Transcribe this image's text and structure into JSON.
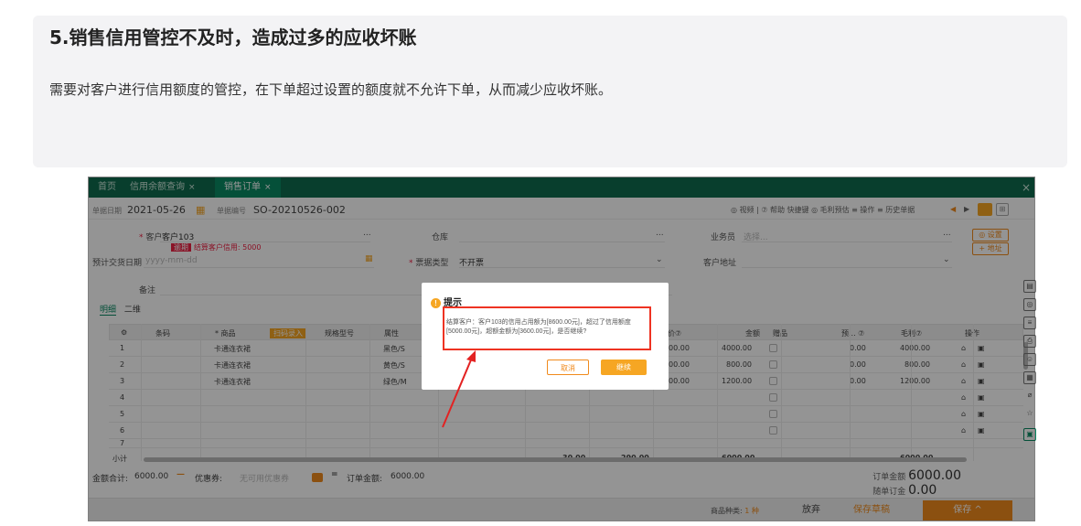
{
  "hero": {
    "title": "5.销售信用管控不及时，造成过多的应收坏账",
    "description": "需要对客户进行信用额度的管控，在下单超过设置的额度就不允许下单，从而减少应收坏账。"
  },
  "tabs": [
    {
      "label": "首页"
    },
    {
      "label": "信用余额查询"
    },
    {
      "label": "销售订单"
    }
  ],
  "tab_close": "×",
  "window_close": "×",
  "toolbar": {
    "date_label": "单据日期",
    "date_value": "2021-05-26",
    "no_label": "单据编号",
    "no_value": "SO-20210526-002",
    "right_items": "◎ 视频 | ⑦ 帮助  快捷键  ◎ 毛利预估  ≡ 操作  ≡ 历史单据"
  },
  "form": {
    "customer_label": "客户",
    "customer_value": "客户103",
    "overdue_tag": "逾期",
    "credit_warning": "结算客户信用: 5000",
    "delivery_label": "预计交货日期",
    "delivery_placeholder": "yyyy-mm-dd",
    "warehouse_label": "仓库",
    "invoice_label": "票据类型",
    "invoice_value": "不开票",
    "salesman_label": "业务员",
    "salesman_placeholder": "选择...",
    "address_label": "客户地址",
    "settings_btn": "◎ 设置",
    "add_btn": "+ 地址",
    "remark_label": "备注",
    "ellipsis": "..."
  },
  "subtabs": [
    "明细",
    "二维"
  ],
  "grid": {
    "headers": [
      "⚙",
      "条码",
      "* 商品",
      "扫码录入",
      "规格型号",
      "属性",
      "价⑦",
      "金额",
      "赠品",
      "预... ⑦",
      "毛利⑦",
      "操作"
    ],
    "rows": [
      {
        "no": "1",
        "product": "卡通连衣裙",
        "attr": "黑色/S",
        "price": "00.00",
        "amount": "4000.00",
        "est": "0.00",
        "profit": "4000.00"
      },
      {
        "no": "2",
        "product": "卡通连衣裙",
        "attr": "黄色/S",
        "price": "00.00",
        "amount": "800.00",
        "est": "0.00",
        "profit": "800.00"
      },
      {
        "no": "3",
        "product": "卡通连衣裙",
        "attr": "绿色/M",
        "price": "00.00",
        "amount": "1200.00",
        "est": "0.00",
        "profit": "1200.00"
      },
      {
        "no": "4"
      },
      {
        "no": "5"
      },
      {
        "no": "6"
      },
      {
        "no": "7"
      }
    ],
    "subtotal_label": "小计",
    "subtotal_qty": "30.00",
    "subtotal_price": "290.00",
    "subtotal_amount": "6000.00",
    "subtotal_profit": "6000.00"
  },
  "summary": {
    "total_label": "金额合计:",
    "total_value": "6000.00",
    "coupon_label": "优惠券:",
    "coupon_placeholder": "无可用优惠券",
    "order_amount_label": "订单金额:",
    "order_amount_value": "6000.00",
    "right_amount_label": "订单金额",
    "right_amount_value": "6000.00",
    "deposit_label": "随单订金",
    "deposit_value": "0.00"
  },
  "footer": {
    "kinds_label": "商品种类:",
    "kinds_value": "1 种",
    "discard_btn": "放弃",
    "draft_btn": "保存草稿",
    "save_btn": "保存 ^"
  },
  "dialog": {
    "title": "提示",
    "message": "结算客户：客户103的信用占用额为[8600.00元]，超过了信用额度[5000.00元]，超额金额为[3600.00元]，是否继续?",
    "cancel": "取消",
    "confirm": "继续"
  },
  "colors": {
    "tab_bar": "#0e6b4f",
    "accent_orange": "#f6a623",
    "highlight_red": "#e32222"
  }
}
